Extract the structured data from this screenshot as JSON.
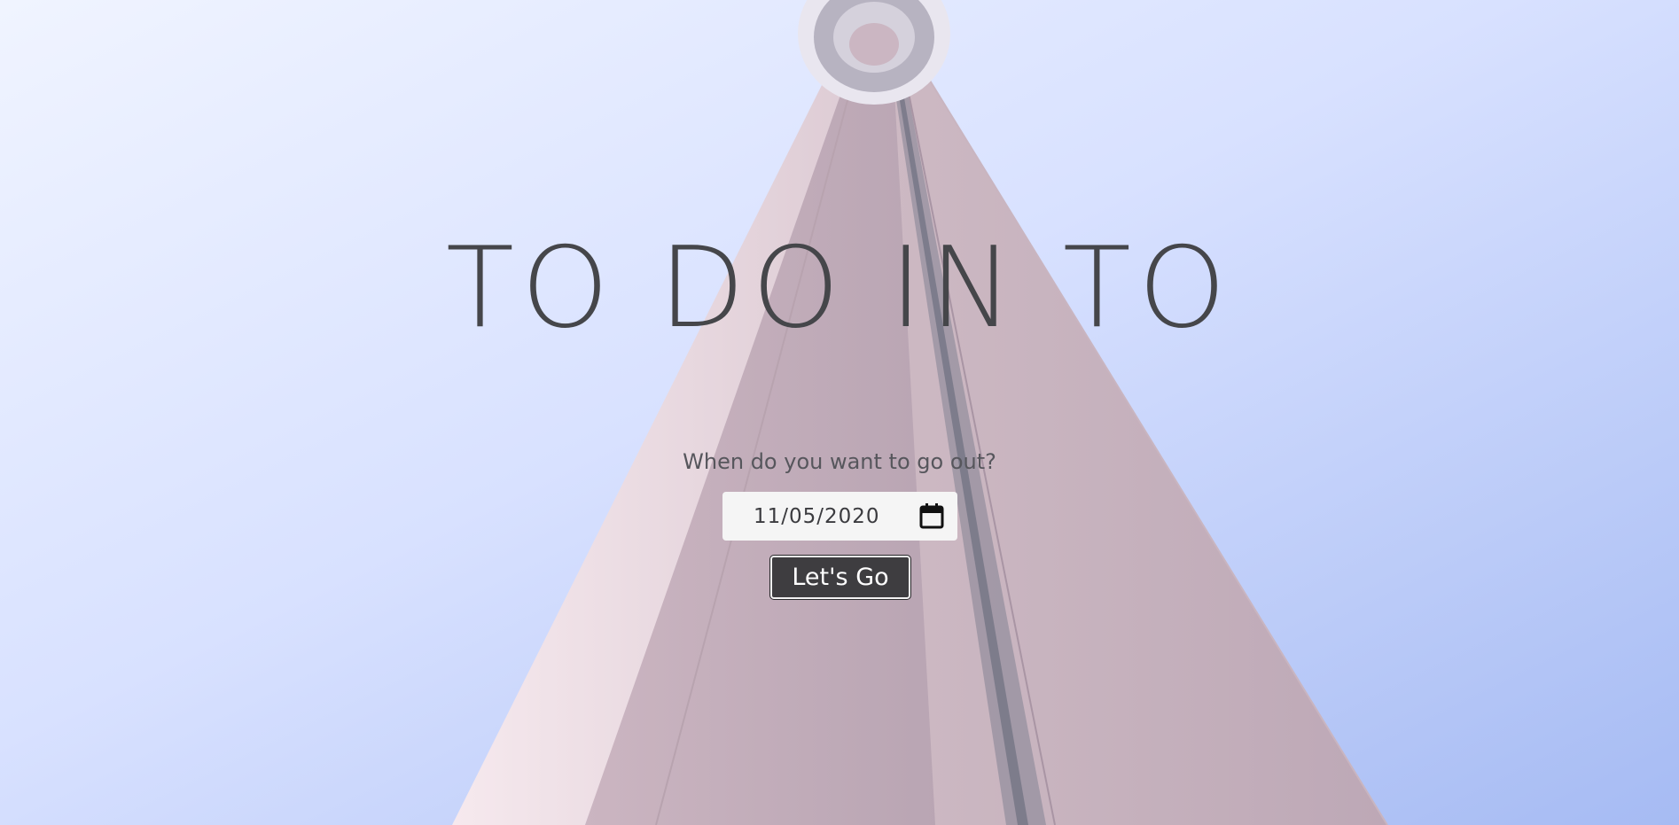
{
  "page": {
    "title": "TO DO IN TO",
    "background_image": "cn-tower-looking-up",
    "sky_color": "#c9d5fb",
    "tower_color": "#cdb8c4"
  },
  "form": {
    "prompt": "When do you want to go out?",
    "date_value": "11/05/2020",
    "calendar_icon": "calendar-icon",
    "submit_label": "Let's Go"
  }
}
